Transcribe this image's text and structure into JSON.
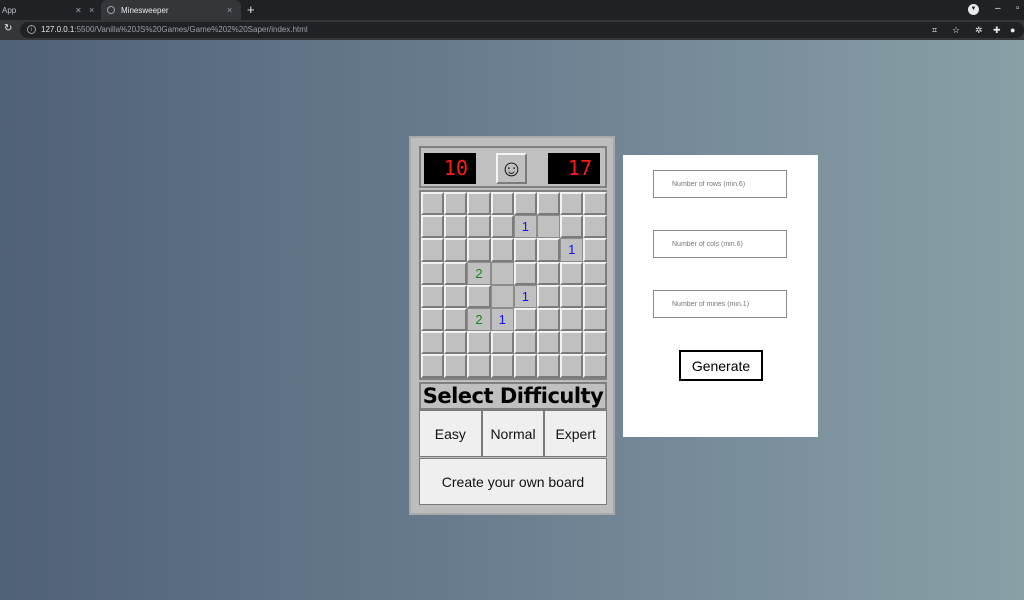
{
  "browser": {
    "tabs": [
      {
        "title": "App",
        "active": false
      },
      {
        "title": "Minesweeper",
        "active": true
      }
    ],
    "new_tab": "+",
    "url_host": "127.0.0.1",
    "url_rest": ":5500/Vanilla%20JS%20Games/Game%202%20Saper/index.html"
  },
  "game": {
    "mines_counter": "10",
    "timer": "17",
    "smiley": "☺",
    "board": {
      "rows": 8,
      "cols": 8,
      "open_cells": [
        {
          "r": 1,
          "c": 4,
          "value": "1"
        },
        {
          "r": 1,
          "c": 5,
          "value": ""
        },
        {
          "r": 2,
          "c": 6,
          "value": "1"
        },
        {
          "r": 3,
          "c": 2,
          "value": "2"
        },
        {
          "r": 3,
          "c": 3,
          "value": ""
        },
        {
          "r": 4,
          "c": 3,
          "value": ""
        },
        {
          "r": 4,
          "c": 4,
          "value": "1"
        },
        {
          "r": 5,
          "c": 2,
          "value": "2"
        },
        {
          "r": 5,
          "c": 3,
          "value": "1"
        }
      ]
    },
    "difficulty_title": "Select Difficulty",
    "difficulty_buttons": [
      "Easy",
      "Normal",
      "Expert"
    ],
    "custom_button": "Create your own board"
  },
  "panel": {
    "rows_placeholder": "Number of rows (min.6)",
    "cols_placeholder": "Number of cols (min.6)",
    "mines_placeholder": "Number of mines (min.1)",
    "generate_label": "Generate"
  },
  "colors": {
    "number_1": "#1010ff",
    "number_2": "#138a13",
    "lcd_text": "#ff1a1a"
  }
}
